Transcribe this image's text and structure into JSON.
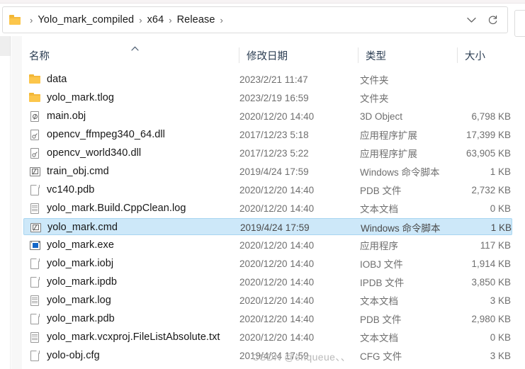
{
  "window": {
    "title": "Release"
  },
  "address_bar": {
    "folder_icon": "folder-icon",
    "separator": "›",
    "crumbs": [
      "Yolo_mark_compiled",
      "x64",
      "Release"
    ],
    "history_dropdown_icon": "chevron-down-icon",
    "refresh_icon": "refresh-icon"
  },
  "columns": [
    {
      "key": "name",
      "label": "名称",
      "sorted": true,
      "sort_direction": "asc"
    },
    {
      "key": "date",
      "label": "修改日期"
    },
    {
      "key": "type",
      "label": "类型"
    },
    {
      "key": "size",
      "label": "大小"
    }
  ],
  "files": [
    {
      "name": "data",
      "date": "2023/2/21 11:47",
      "type": "文件夹",
      "size": "",
      "icon": "folder-icon",
      "selected": false
    },
    {
      "name": "yolo_mark.tlog",
      "date": "2023/2/19 16:59",
      "type": "文件夹",
      "size": "",
      "icon": "folder-icon",
      "selected": false
    },
    {
      "name": "main.obj",
      "date": "2020/12/20 14:40",
      "type": "3D Object",
      "size": "6,798 KB",
      "icon": "3d-object-file-icon",
      "selected": false
    },
    {
      "name": "opencv_ffmpeg340_64.dll",
      "date": "2017/12/23 5:18",
      "type": "应用程序扩展",
      "size": "17,399 KB",
      "icon": "dll-file-icon",
      "selected": false
    },
    {
      "name": "opencv_world340.dll",
      "date": "2017/12/23 5:22",
      "type": "应用程序扩展",
      "size": "63,905 KB",
      "icon": "dll-file-icon",
      "selected": false
    },
    {
      "name": "train_obj.cmd",
      "date": "2019/4/24 17:59",
      "type": "Windows 命令脚本",
      "size": "1 KB",
      "icon": "cmd-script-icon",
      "selected": false
    },
    {
      "name": "vc140.pdb",
      "date": "2020/12/20 14:40",
      "type": "PDB 文件",
      "size": "2,732 KB",
      "icon": "generic-file-icon",
      "selected": false
    },
    {
      "name": "yolo_mark.Build.CppClean.log",
      "date": "2020/12/20 14:40",
      "type": "文本文档",
      "size": "0 KB",
      "icon": "text-file-icon",
      "selected": false
    },
    {
      "name": "yolo_mark.cmd",
      "date": "2019/4/24 17:59",
      "type": "Windows 命令脚本",
      "size": "1 KB",
      "icon": "cmd-script-icon",
      "selected": true
    },
    {
      "name": "yolo_mark.exe",
      "date": "2020/12/20 14:40",
      "type": "应用程序",
      "size": "117 KB",
      "icon": "executable-icon",
      "selected": false
    },
    {
      "name": "yolo_mark.iobj",
      "date": "2020/12/20 14:40",
      "type": "IOBJ 文件",
      "size": "1,914 KB",
      "icon": "generic-file-icon",
      "selected": false
    },
    {
      "name": "yolo_mark.ipdb",
      "date": "2020/12/20 14:40",
      "type": "IPDB 文件",
      "size": "3,850 KB",
      "icon": "generic-file-icon",
      "selected": false
    },
    {
      "name": "yolo_mark.log",
      "date": "2020/12/20 14:40",
      "type": "文本文档",
      "size": "3 KB",
      "icon": "text-file-icon",
      "selected": false
    },
    {
      "name": "yolo_mark.pdb",
      "date": "2020/12/20 14:40",
      "type": "PDB 文件",
      "size": "2,980 KB",
      "icon": "generic-file-icon",
      "selected": false
    },
    {
      "name": "yolo_mark.vcxproj.FileListAbsolute.txt",
      "date": "2020/12/20 14:40",
      "type": "文本文档",
      "size": "0 KB",
      "icon": "text-file-icon",
      "selected": false
    },
    {
      "name": "yolo-obj.cfg",
      "date": "2019/4/24 17:59",
      "type": "CFG 文件",
      "size": "3 KB",
      "icon": "generic-file-icon",
      "selected": false
    }
  ],
  "watermark": {
    "text": "CSDN @enqueue、、"
  },
  "colors": {
    "selection": "#cde8f9",
    "selection_border": "#a8d5f0",
    "folder": "#fcc64b",
    "exe_accent": "#1266c8",
    "header_text": "#2b3d52",
    "secondary_text": "#6f6f6f"
  }
}
